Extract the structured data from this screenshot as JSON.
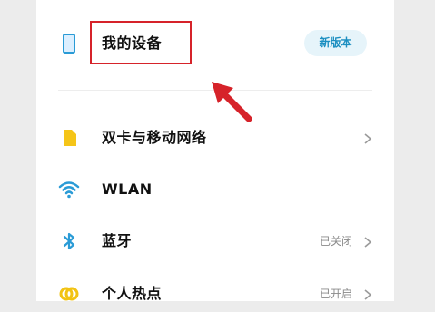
{
  "device_row": {
    "label": "我的设备",
    "badge": "新版本"
  },
  "settings": {
    "items": [
      {
        "key": "sim",
        "label": "双卡与移动网络",
        "status": "",
        "icon": "sim-card-icon"
      },
      {
        "key": "wlan",
        "label": "WLAN",
        "status": "",
        "icon": "wifi-icon"
      },
      {
        "key": "bluetooth",
        "label": "蓝牙",
        "status": "已关闭",
        "icon": "bluetooth-icon"
      },
      {
        "key": "hotspot",
        "label": "个人热点",
        "status": "已开启",
        "icon": "hotspot-icon"
      }
    ]
  },
  "colors": {
    "accent": "#1c8fc1",
    "sim_icon": "#f5c518",
    "bluetooth_icon": "#2a9bd6",
    "hotspot_icon": "#f2c313",
    "annotation": "#d6232a"
  }
}
